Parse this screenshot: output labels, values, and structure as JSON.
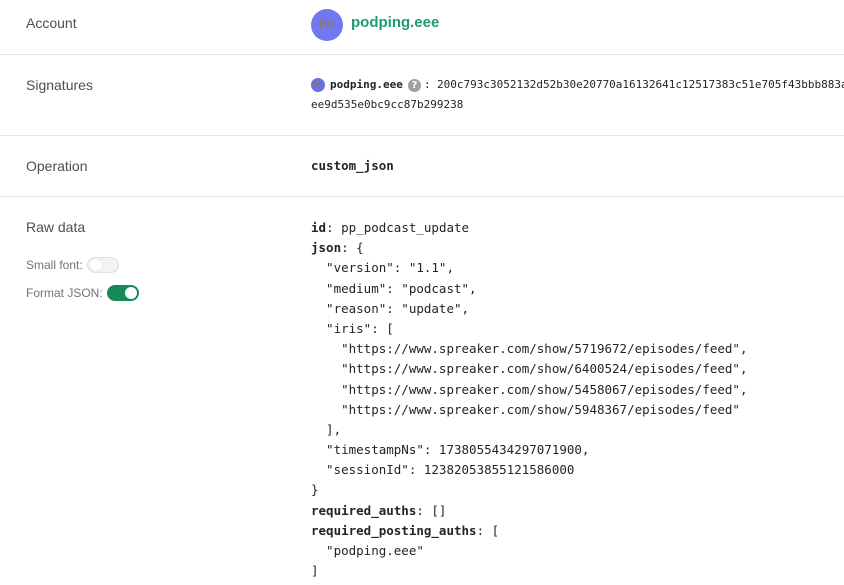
{
  "account": {
    "label": "Account",
    "avatar_initials": "PO",
    "name": "podping.eee",
    "name_color": "#1a9e6a",
    "avatar_color": "#7077f0"
  },
  "signatures": {
    "label": "Signatures",
    "avatar_initials": "PO",
    "name": "podping.eee",
    "help_icon": "question-circle-icon",
    "help_glyph": "?",
    "colon": ":",
    "hex_part1": "200c793c3052132d52b30e20770a16132641c12517383c51e705f43bbb883a",
    "hex_part2": "ee9d535e0bc9cc87b299238"
  },
  "operation": {
    "label": "Operation",
    "value": "custom_json"
  },
  "raw_data": {
    "label": "Raw data",
    "small_font": {
      "label": "Small font:",
      "enabled": false
    },
    "format_json": {
      "label": "Format JSON:",
      "enabled": true,
      "color": "#158a57"
    },
    "lines": [
      {
        "key": "id",
        "rest": ": pp_podcast_update"
      },
      {
        "key": "json",
        "rest": ": {"
      },
      {
        "key": "",
        "rest": "  \"version\": \"1.1\","
      },
      {
        "key": "",
        "rest": "  \"medium\": \"podcast\","
      },
      {
        "key": "",
        "rest": "  \"reason\": \"update\","
      },
      {
        "key": "",
        "rest": "  \"iris\": ["
      },
      {
        "key": "",
        "rest": "    \"https://www.spreaker.com/show/5719672/episodes/feed\","
      },
      {
        "key": "",
        "rest": "    \"https://www.spreaker.com/show/6400524/episodes/feed\","
      },
      {
        "key": "",
        "rest": "    \"https://www.spreaker.com/show/5458067/episodes/feed\","
      },
      {
        "key": "",
        "rest": "    \"https://www.spreaker.com/show/5948367/episodes/feed\""
      },
      {
        "key": "",
        "rest": "  ],"
      },
      {
        "key": "",
        "rest": "  \"timestampNs\": 1738055434297071900,"
      },
      {
        "key": "",
        "rest": "  \"sessionId\": 12382053855121586000"
      },
      {
        "key": "",
        "rest": "}"
      },
      {
        "key": "required_auths",
        "rest": ": []"
      },
      {
        "key": "required_posting_auths",
        "rest": ": ["
      },
      {
        "key": "",
        "rest": "  \"podping.eee\""
      },
      {
        "key": "",
        "rest": "]"
      }
    ]
  }
}
